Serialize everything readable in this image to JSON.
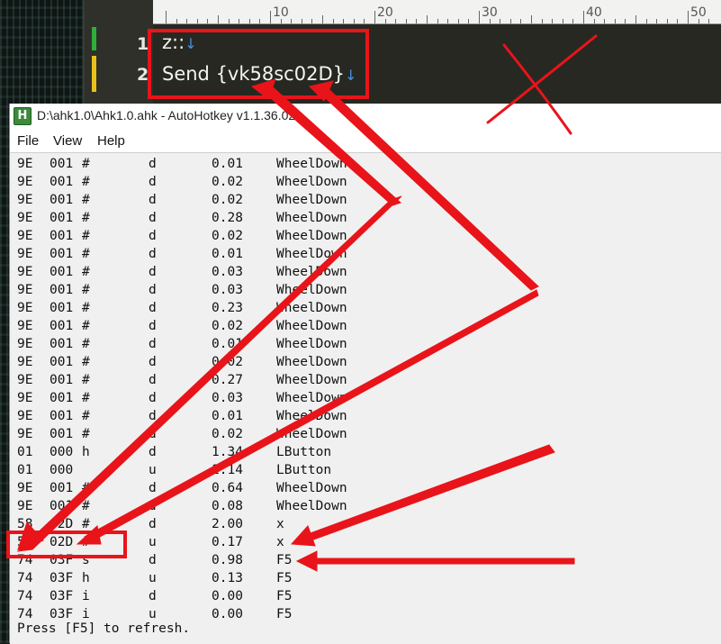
{
  "editor": {
    "ruler_numbers": [
      "10",
      "20",
      "30",
      "40",
      "50"
    ],
    "lines": [
      {
        "num": "1",
        "code": "z::",
        "newline": "↓"
      },
      {
        "num": "2",
        "code": "Send {vk58sc02D}",
        "newline": "↓"
      }
    ]
  },
  "window": {
    "icon_letter": "H",
    "title": "D:\\ahk1.0\\Ahk1.0.ahk - AutoHotkey v1.1.36.02",
    "menu": [
      "File",
      "View",
      "Help"
    ]
  },
  "key_history": [
    {
      "vk": "9E",
      "sc": "001",
      "flags": "#",
      "updown": "d",
      "elapsed": "0.01",
      "key": "WheelDown"
    },
    {
      "vk": "9E",
      "sc": "001",
      "flags": "#",
      "updown": "d",
      "elapsed": "0.02",
      "key": "WheelDown"
    },
    {
      "vk": "9E",
      "sc": "001",
      "flags": "#",
      "updown": "d",
      "elapsed": "0.02",
      "key": "WheelDown"
    },
    {
      "vk": "9E",
      "sc": "001",
      "flags": "#",
      "updown": "d",
      "elapsed": "0.28",
      "key": "WheelDown"
    },
    {
      "vk": "9E",
      "sc": "001",
      "flags": "#",
      "updown": "d",
      "elapsed": "0.02",
      "key": "WheelDown"
    },
    {
      "vk": "9E",
      "sc": "001",
      "flags": "#",
      "updown": "d",
      "elapsed": "0.01",
      "key": "WheelDown"
    },
    {
      "vk": "9E",
      "sc": "001",
      "flags": "#",
      "updown": "d",
      "elapsed": "0.03",
      "key": "WheelDown"
    },
    {
      "vk": "9E",
      "sc": "001",
      "flags": "#",
      "updown": "d",
      "elapsed": "0.03",
      "key": "WheelDown"
    },
    {
      "vk": "9E",
      "sc": "001",
      "flags": "#",
      "updown": "d",
      "elapsed": "0.23",
      "key": "WheelDown"
    },
    {
      "vk": "9E",
      "sc": "001",
      "flags": "#",
      "updown": "d",
      "elapsed": "0.02",
      "key": "WheelDown"
    },
    {
      "vk": "9E",
      "sc": "001",
      "flags": "#",
      "updown": "d",
      "elapsed": "0.01",
      "key": "WheelDown"
    },
    {
      "vk": "9E",
      "sc": "001",
      "flags": "#",
      "updown": "d",
      "elapsed": "0.02",
      "key": "WheelDown"
    },
    {
      "vk": "9E",
      "sc": "001",
      "flags": "#",
      "updown": "d",
      "elapsed": "0.27",
      "key": "WheelDown"
    },
    {
      "vk": "9E",
      "sc": "001",
      "flags": "#",
      "updown": "d",
      "elapsed": "0.03",
      "key": "WheelDown"
    },
    {
      "vk": "9E",
      "sc": "001",
      "flags": "#",
      "updown": "d",
      "elapsed": "0.01",
      "key": "WheelDown"
    },
    {
      "vk": "9E",
      "sc": "001",
      "flags": "#",
      "updown": "d",
      "elapsed": "0.02",
      "key": "WheelDown"
    },
    {
      "vk": "01",
      "sc": "000",
      "flags": "h",
      "updown": "d",
      "elapsed": "1.34",
      "key": "LButton"
    },
    {
      "vk": "01",
      "sc": "000",
      "flags": "",
      "updown": "u",
      "elapsed": "1.14",
      "key": "LButton"
    },
    {
      "vk": "9E",
      "sc": "001",
      "flags": "#",
      "updown": "d",
      "elapsed": "0.64",
      "key": "WheelDown"
    },
    {
      "vk": "9E",
      "sc": "001",
      "flags": "#",
      "updown": "d",
      "elapsed": "0.08",
      "key": "WheelDown"
    },
    {
      "vk": "58",
      "sc": "02D",
      "flags": "#",
      "updown": "d",
      "elapsed": "2.00",
      "key": "x"
    },
    {
      "vk": "58",
      "sc": "02D",
      "flags": "#",
      "updown": "u",
      "elapsed": "0.17",
      "key": "x"
    },
    {
      "vk": "74",
      "sc": "03F",
      "flags": "s",
      "updown": "d",
      "elapsed": "0.98",
      "key": "F5"
    },
    {
      "vk": "74",
      "sc": "03F",
      "flags": "h",
      "updown": "u",
      "elapsed": "0.13",
      "key": "F5"
    },
    {
      "vk": "74",
      "sc": "03F",
      "flags": "i",
      "updown": "d",
      "elapsed": "0.00",
      "key": "F5"
    },
    {
      "vk": "74",
      "sc": "03F",
      "flags": "i",
      "updown": "u",
      "elapsed": "0.00",
      "key": "F5"
    }
  ],
  "footer": "Press [F5] to refresh.",
  "annotation_color": "#e8141a"
}
